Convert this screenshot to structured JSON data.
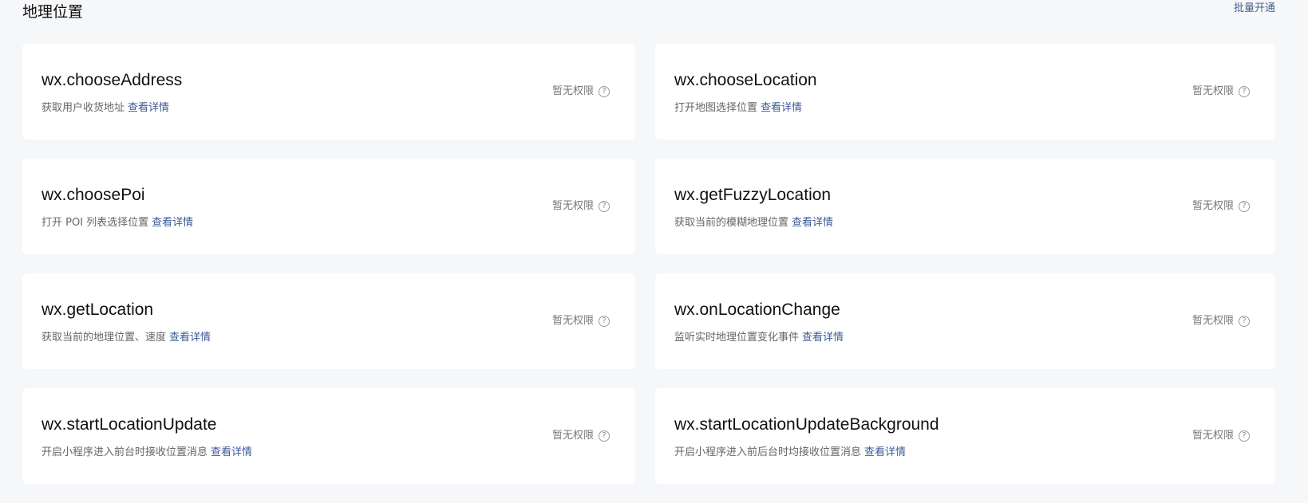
{
  "header": {
    "title": "地理位置",
    "bulk_open_label": "批量开通"
  },
  "apis": [
    {
      "name": "wx.chooseAddress",
      "description": "获取用户收货地址",
      "detail_label": "查看详情",
      "status": "暂无权限"
    },
    {
      "name": "wx.chooseLocation",
      "description": "打开地图选择位置",
      "detail_label": "查看详情",
      "status": "暂无权限"
    },
    {
      "name": "wx.choosePoi",
      "description": "打开 POI 列表选择位置",
      "detail_label": "查看详情",
      "status": "暂无权限"
    },
    {
      "name": "wx.getFuzzyLocation",
      "description": "获取当前的模糊地理位置",
      "detail_label": "查看详情",
      "status": "暂无权限"
    },
    {
      "name": "wx.getLocation",
      "description": "获取当前的地理位置、速度",
      "detail_label": "查看详情",
      "status": "暂无权限"
    },
    {
      "name": "wx.onLocationChange",
      "description": "监听实时地理位置变化事件",
      "detail_label": "查看详情",
      "status": "暂无权限"
    },
    {
      "name": "wx.startLocationUpdate",
      "description": "开启小程序进入前台时接收位置消息",
      "detail_label": "查看详情",
      "status": "暂无权限"
    },
    {
      "name": "wx.startLocationUpdateBackground",
      "description": "开启小程序进入前后台时均接收位置消息",
      "detail_label": "查看详情",
      "status": "暂无权限"
    }
  ],
  "icons": {
    "help": "question-circle-icon"
  },
  "colors": {
    "page_background": "#f6f7f9",
    "card_background": "#ffffff",
    "link": "#3d5a98",
    "muted_text": "#777777"
  }
}
